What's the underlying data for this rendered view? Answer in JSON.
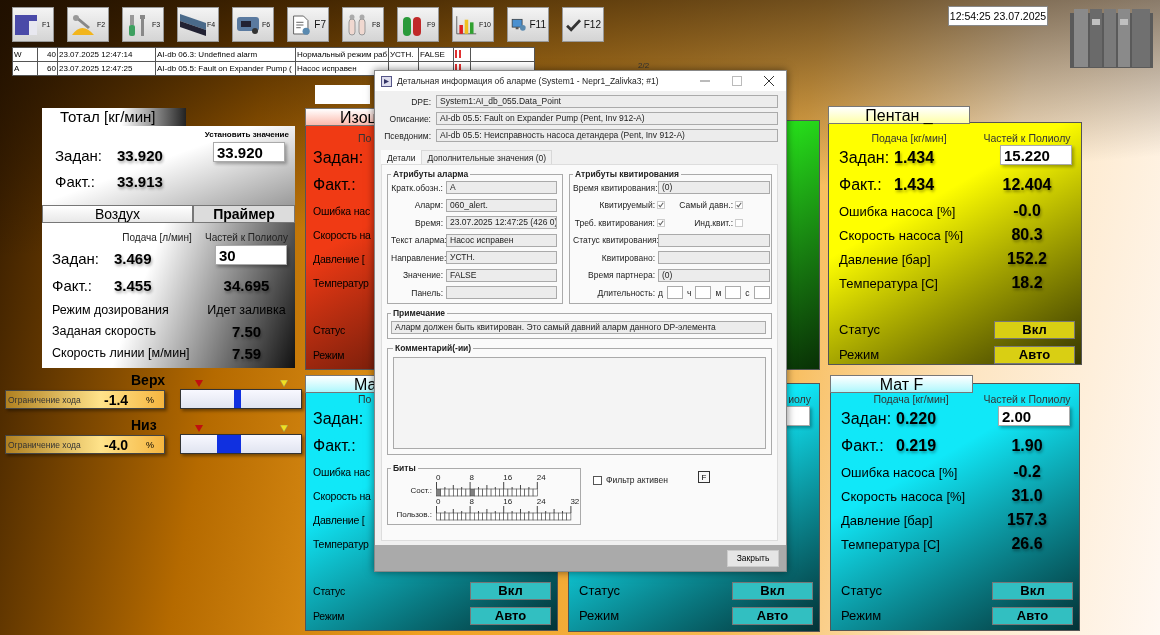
{
  "toolbar": [
    {
      "label": "F1"
    },
    {
      "label": "F2"
    },
    {
      "label": "F3"
    },
    {
      "label": "F4"
    },
    {
      "label": "F6"
    },
    {
      "label": "F7"
    },
    {
      "label": "F8"
    },
    {
      "label": "F9"
    },
    {
      "label": "F10"
    },
    {
      "label": "F11"
    },
    {
      "label": "F12"
    }
  ],
  "clock": "12:54:25 23.07.2025",
  "alarm_table": {
    "rows": [
      {
        "cells": [
          "W",
          "40",
          "23.07.2025 12:47:14",
          "AI-db 06.3: Undefined alarm",
          "Нормальный режим раб",
          "УСТН.",
          "FALSE"
        ],
        "unacknowledged": true
      },
      {
        "cells": [
          "A",
          "60",
          "23.07.2025 12:47:25",
          "AI-db 05.5: Fault on Expander Pump (",
          "Насос исправен"
        ],
        "unacknowledged": true
      }
    ]
  },
  "page_indicator": "2/2",
  "total_panel": {
    "title": "Тотал [кг/мин]",
    "set_label": "Установить значение",
    "rows": [
      {
        "label": "Задан:",
        "value": "33.920",
        "input": "33.920"
      },
      {
        "label": "Факт.:",
        "value": "33.913"
      }
    ]
  },
  "component_tabs": [
    {
      "label": "Воздух",
      "selected": false
    },
    {
      "label": "Праймер",
      "selected": true
    }
  ],
  "component_panel": {
    "headings": {
      "flow": "Подача [л/мин]",
      "ratio": "Частей к Полиолу"
    },
    "rows": [
      {
        "kind": "setpoint",
        "label": "Задан:",
        "value": "3.469",
        "ratio": "30"
      },
      {
        "kind": "actual",
        "label": "Факт.:",
        "value": "3.455",
        "ratio": "34.695"
      },
      {
        "kind": "status",
        "label": "Режим дозирования",
        "ratio": "Идет заливка"
      },
      {
        "kind": "reading",
        "label": "Заданая скорость",
        "ratio": "7.50"
      },
      {
        "kind": "reading",
        "label": "Скорость линии [м/мин]",
        "ratio": "7.59"
      }
    ]
  },
  "stroke_limits": [
    {
      "title": "Верх",
      "label": "Ограничение хода",
      "value": "-1.4",
      "unit": "%",
      "kind": "marker",
      "level": 0.47
    },
    {
      "title": "Низ",
      "label": "Ограничение хода",
      "value": "-4.0",
      "unit": "%",
      "kind": "block",
      "level": 0.4
    }
  ],
  "pump_panels": [
    {
      "title": "Изоц",
      "color": "#f03a14",
      "headings": {
        "flow": "По"
      },
      "rows": [
        {
          "kind": "setpoint",
          "label": "Задан:"
        },
        {
          "kind": "actual",
          "label": "Факт.:"
        },
        {
          "kind": "reading",
          "label": "Ошибка нас"
        },
        {
          "kind": "reading",
          "label": "Скорость на"
        },
        {
          "kind": "reading",
          "label": "Давление ["
        },
        {
          "kind": "reading",
          "label": "Температур"
        }
      ],
      "controls": [
        {
          "label": "Статус"
        },
        {
          "label": "Режим"
        }
      ]
    },
    {
      "color": "#26dc1a"
    },
    {
      "title": "Ма",
      "color": "#10e8f8",
      "headings": {
        "flow": "По"
      },
      "rows": [
        {
          "kind": "setpoint",
          "label": "Задан:"
        },
        {
          "kind": "actual",
          "label": "Факт.:"
        },
        {
          "kind": "reading",
          "label": "Ошибка нас"
        },
        {
          "kind": "reading",
          "label": "Скорость на"
        },
        {
          "kind": "reading",
          "label": "Давление ["
        },
        {
          "kind": "reading",
          "label": "Температур"
        }
      ],
      "controls": [
        {
          "label": "Статус",
          "button": "Вкл"
        },
        {
          "label": "Режим",
          "button": "Авто"
        }
      ]
    },
    {
      "color": "#10e8f8",
      "headings": {
        "ratio": "иолу"
      },
      "rows": [
        {
          "kind": "entry"
        }
      ],
      "controls": [
        {
          "label": "Статус",
          "button": "Вкл"
        },
        {
          "label": "Режим",
          "button": "Авто"
        }
      ]
    },
    {
      "title": "Пентан _",
      "color": "#ffff00",
      "headings": {
        "flow": "Подача [кг/мин]",
        "ratio": "Частей к Полиолу"
      },
      "rows": [
        {
          "kind": "setpoint",
          "label": "Задан:",
          "value": "1.434",
          "ratio": "15.220"
        },
        {
          "kind": "actual",
          "label": "Факт.:",
          "value": "1.434",
          "ratio": "12.404"
        },
        {
          "kind": "reading",
          "label": "Ошибка насоса [%]",
          "ratio": "-0.0"
        },
        {
          "kind": "reading",
          "label": "Скорость насоса [%]",
          "ratio": "80.3"
        },
        {
          "kind": "reading",
          "label": "Давление  [бар]",
          "ratio": "152.2"
        },
        {
          "kind": "reading",
          "label": "Температура  [C]",
          "ratio": "18.2"
        }
      ],
      "controls": [
        {
          "label": "Статус",
          "button": "Вкл"
        },
        {
          "label": "Режим",
          "button": "Авто"
        }
      ]
    },
    {
      "title": "Мат F",
      "color": "#10e8f8",
      "headings": {
        "flow": "Подача [кг/мин]",
        "ratio": "Частей к Полиолу"
      },
      "rows": [
        {
          "kind": "setpoint",
          "label": "Задан:",
          "value": "0.220",
          "ratio": "2.00"
        },
        {
          "kind": "actual",
          "label": "Факт.:",
          "value": "0.219",
          "ratio": "1.90"
        },
        {
          "kind": "reading",
          "label": "Ошибка насоса [%]",
          "ratio": "-0.2"
        },
        {
          "kind": "reading",
          "label": "Скорость насоса [%]",
          "ratio": "31.0"
        },
        {
          "kind": "reading",
          "label": "Давление  [бар]",
          "ratio": "157.3"
        },
        {
          "kind": "reading",
          "label": "Температура  [C]",
          "ratio": "26.6"
        }
      ],
      "controls": [
        {
          "label": "Статус",
          "button": "Вкл"
        },
        {
          "label": "Режим",
          "button": "Авто"
        }
      ]
    }
  ],
  "alarm_dialog": {
    "title": "Детальная информация об аларме (System1 - Nepr1_Zalivka3; #1)",
    "fields": [
      {
        "label": "DPE:",
        "value": "System1:AI_db_055.Data_Point"
      },
      {
        "label": "Описание:",
        "value": "AI-db 05.5: Fault on Expander Pump (Pent, Inv 912-A)"
      },
      {
        "label": "Псевдоним:",
        "value": "AI-db 05.5: Неисправность насоса детандера (Pent, Inv 912-A)"
      }
    ],
    "tabs": [
      {
        "label": "Детали",
        "selected": true
      },
      {
        "label": "Дополнительные значения (0)",
        "selected": false
      }
    ],
    "alarm_attributes": {
      "title": "Атрибуты аларма",
      "fields": [
        {
          "label": "Кратк.обозн.:",
          "value": "A"
        },
        {
          "label": "Аларм:",
          "value": "060_alert."
        },
        {
          "label": "Время:",
          "value": "23.07.2025 12:47:25 (426 0)"
        },
        {
          "label": "Текст аларма:",
          "value": "Насос исправен"
        },
        {
          "label": "Направление:",
          "value": "УСТН."
        },
        {
          "label": "Значение:",
          "value": "FALSE"
        },
        {
          "label": "Панель:"
        }
      ]
    },
    "ack_attributes": {
      "title": "Атрибуты квитирования",
      "items": [
        {
          "kind": "field",
          "label": "Время квитирования:",
          "value": "(0)"
        },
        {
          "kind": "checks",
          "checks": [
            {
              "label": "Квитируемый:",
              "checked": true,
              "disabled": true
            },
            {
              "label": "Самый давн.:",
              "checked": true,
              "disabled": true
            }
          ]
        },
        {
          "kind": "checks",
          "checks": [
            {
              "label": "Треб. квитирования:",
              "checked": true,
              "disabled": true
            },
            {
              "label": "Инд.квит.:",
              "checked": false,
              "disabled": true
            }
          ]
        },
        {
          "kind": "field",
          "label": "Статус квитирования:"
        },
        {
          "kind": "field",
          "label": "Квитировано:"
        },
        {
          "kind": "field",
          "label": "Время партнера:",
          "value": "(0)"
        },
        {
          "kind": "duration",
          "label": "Длительность:",
          "units": [
            "д",
            "ч",
            "м",
            "с"
          ]
        }
      ]
    },
    "note": {
      "title": "Примечание",
      "text": "Аларм должен быть квитирован. Это самый давний аларм данного DP-элемента"
    },
    "comments": {
      "title": "Комментарий(-ии)"
    },
    "bits": {
      "title": "Биты",
      "rows": [
        {
          "label": "Сост.:",
          "ticks": [
            "0",
            "8",
            "16",
            "24"
          ],
          "cells": [
            true,
            false,
            false,
            false,
            false,
            false,
            false,
            false,
            true,
            false,
            false,
            false,
            false,
            false,
            false,
            false,
            false,
            false,
            false,
            false,
            false,
            false,
            false,
            false
          ]
        },
        {
          "label": "Пользов.:",
          "ticks": [
            "0",
            "8",
            "16",
            "24",
            "32"
          ],
          "cells": [
            false,
            false,
            false,
            false,
            false,
            false,
            false,
            false,
            false,
            false,
            false,
            false,
            false,
            false,
            false,
            false,
            false,
            false,
            false,
            false,
            false,
            false,
            false,
            false,
            false,
            false,
            false,
            false,
            false,
            false,
            false,
            false
          ]
        }
      ]
    },
    "filter": {
      "label": "Фильтр активен",
      "checked": false
    },
    "filter_button": "F",
    "close_button": "Закрыть"
  }
}
